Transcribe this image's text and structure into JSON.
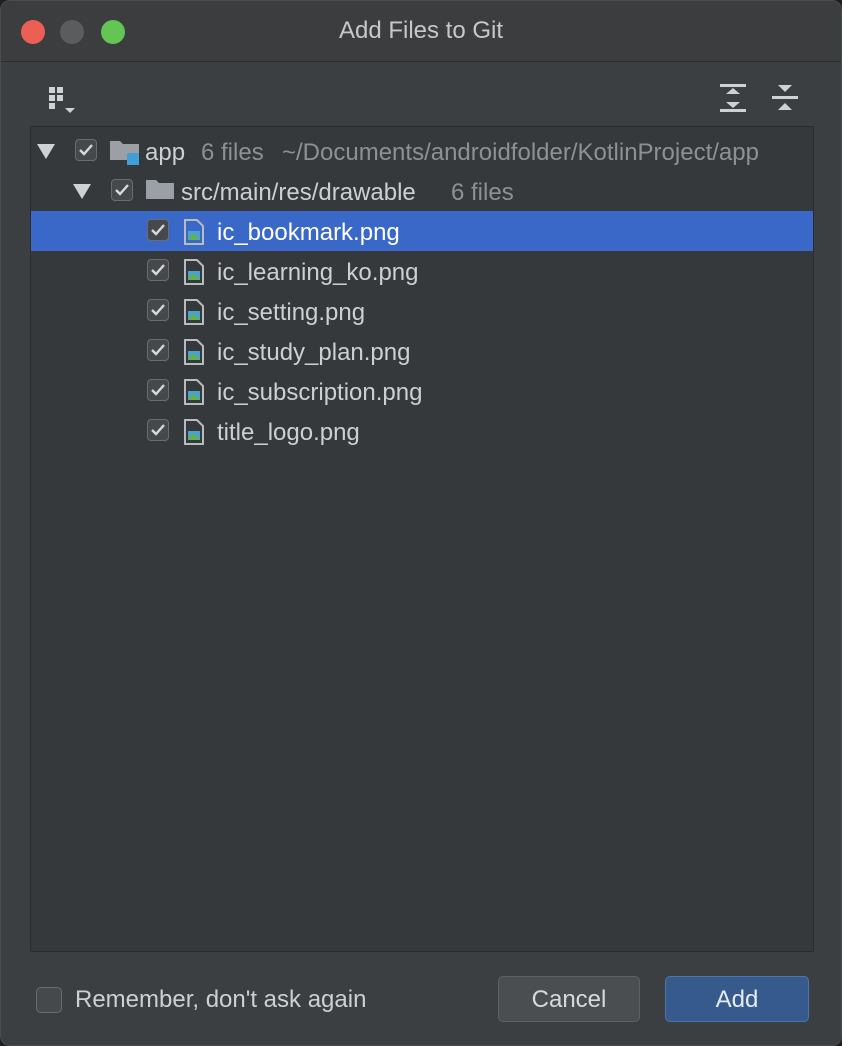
{
  "window": {
    "title": "Add Files to Git"
  },
  "toolbar": {
    "group_icon": "group-by-icon",
    "expand_icon": "expand-all-icon",
    "collapse_icon": "collapse-all-icon"
  },
  "tree": {
    "root": {
      "name": "app",
      "count": "6 files",
      "path": "~/Documents/androidfolder/KotlinProject/app",
      "checked": true
    },
    "folder": {
      "name": "src/main/res/drawable",
      "count": "6 files",
      "checked": true
    },
    "files": [
      {
        "name": "ic_bookmark.png",
        "checked": true,
        "selected": true
      },
      {
        "name": "ic_learning_ko.png",
        "checked": true
      },
      {
        "name": "ic_setting.png",
        "checked": true
      },
      {
        "name": "ic_study_plan.png",
        "checked": true
      },
      {
        "name": "ic_subscription.png",
        "checked": true
      },
      {
        "name": "title_logo.png",
        "checked": true
      }
    ]
  },
  "footer": {
    "remember_label": "Remember, don't ask again",
    "remember_checked": false,
    "cancel_label": "Cancel",
    "add_label": "Add"
  },
  "colors": {
    "selection": "#3a68c8",
    "add_button": "#375a8c"
  }
}
